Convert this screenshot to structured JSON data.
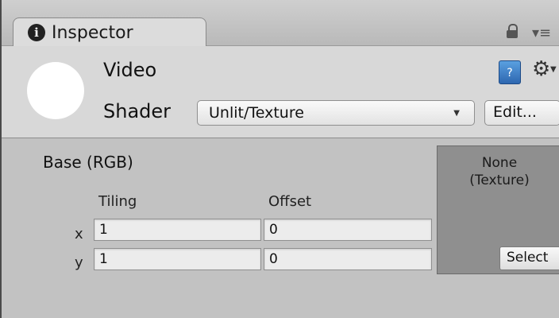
{
  "tab": {
    "title": "Inspector",
    "info_glyph": "i"
  },
  "material": {
    "name": "Video",
    "shader_label": "Shader",
    "shader_value": "Unlit/Texture",
    "edit_label": "Edit...",
    "help_glyph": "?"
  },
  "property": {
    "label": "Base (RGB)",
    "tiling_label": "Tiling",
    "offset_label": "Offset",
    "x_label": "x",
    "y_label": "y",
    "tiling_x": "1",
    "tiling_y": "1",
    "offset_x": "0",
    "offset_y": "0",
    "texture_text_line1": "None",
    "texture_text_line2": "(Texture)",
    "select_label": "Select"
  },
  "icons": [
    "info-icon",
    "lock-icon",
    "tab-menu-icon",
    "help-icon",
    "gear-icon",
    "dropdown-arrow-icon"
  ]
}
